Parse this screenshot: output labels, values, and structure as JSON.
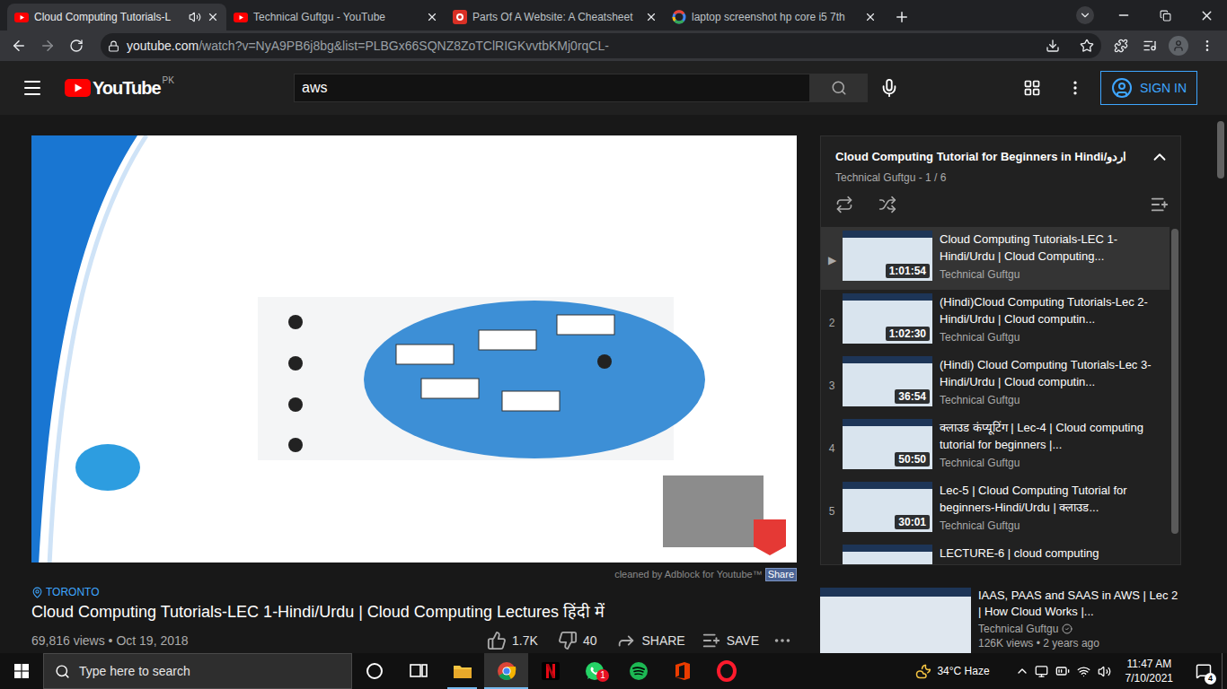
{
  "browser": {
    "tabs": [
      {
        "title": "Cloud Computing Tutorials-L",
        "selected": true,
        "audio": true,
        "kind": "youtube"
      },
      {
        "title": "Technical Guftgu - YouTube",
        "selected": false,
        "audio": false,
        "kind": "youtube"
      },
      {
        "title": "Parts Of A Website: A Cheatsheet",
        "selected": false,
        "audio": false,
        "kind": "cheatsheet"
      },
      {
        "title": "laptop screenshot hp core i5 7th",
        "selected": false,
        "audio": false,
        "kind": "google"
      }
    ],
    "url_host": "youtube.com",
    "url_path": "/watch?v=NyA9PB6j8bg&list=PLBGx66SQNZ8ZoTClRIGKvvtbKMj0rqCL-"
  },
  "youtube_header": {
    "logo": "YouTube",
    "region": "PK",
    "search_value": "aws",
    "sign_in": "SIGN IN"
  },
  "video": {
    "adblock_note": "cleaned by Adblock for Youtube™",
    "share_badge": "Share",
    "location": "TORONTO",
    "title": "Cloud Computing Tutorials-LEC 1-Hindi/Urdu | Cloud Computing Lectures हिंदी में",
    "meta": "69,816 views • Oct 19, 2018",
    "likes": "1.7K",
    "dislikes": "40",
    "share": "SHARE",
    "save": "SAVE"
  },
  "playlist": {
    "title": "Cloud Computing Tutorial for Beginners in Hindi/اردو",
    "subtitle": "Technical Guftgu - 1 / 6",
    "items": [
      {
        "index": "▶",
        "title": "Cloud Computing Tutorials-LEC 1-Hindi/Urdu | Cloud Computing...",
        "channel": "Technical Guftgu",
        "duration": "1:01:54",
        "selected": true
      },
      {
        "index": "2",
        "title": "(Hindi)Cloud Computing Tutorials-Lec 2-Hindi/Urdu | Cloud computin...",
        "channel": "Technical Guftgu",
        "duration": "1:02:30",
        "selected": false
      },
      {
        "index": "3",
        "title": "(Hindi) Cloud Computing Tutorials-Lec 3-Hindi/Urdu | Cloud computin...",
        "channel": "Technical Guftgu",
        "duration": "36:54",
        "selected": false
      },
      {
        "index": "4",
        "title": "क्लाउड कंप्यूटिंग | Lec-4 | Cloud computing tutorial for beginners |...",
        "channel": "Technical Guftgu",
        "duration": "50:50",
        "selected": false
      },
      {
        "index": "5",
        "title": "Lec-5 | Cloud Computing Tutorial for beginners-Hindi/Urdu | क्लाउड...",
        "channel": "Technical Guftgu",
        "duration": "30:01",
        "selected": false
      },
      {
        "title": "LECTURE-6 | cloud computing",
        "selected": false
      }
    ]
  },
  "recommended": [
    {
      "title": "IAAS, PAAS and SAAS in AWS | Lec 2 | How Cloud Works |...",
      "channel": "Technical Guftgu",
      "verified": true,
      "meta": "126K views • 2 years ago"
    }
  ],
  "taskbar": {
    "search_placeholder": "Type here to search",
    "apps": [
      {
        "kind": "cortana",
        "active": false,
        "running": false
      },
      {
        "kind": "task-view",
        "active": false,
        "running": false
      },
      {
        "kind": "file-explorer",
        "active": false,
        "running": true
      },
      {
        "kind": "chrome",
        "active": true,
        "running": true
      },
      {
        "kind": "netflix",
        "active": false,
        "running": false
      },
      {
        "kind": "whatsapp",
        "active": false,
        "running": false,
        "badge": "1"
      },
      {
        "kind": "spotify",
        "active": false,
        "running": false
      },
      {
        "kind": "office",
        "active": false,
        "running": false
      },
      {
        "kind": "opera",
        "active": false,
        "running": false
      }
    ],
    "weather": "34°C Haze",
    "time": "11:47 AM",
    "date": "7/10/2021",
    "notifications": "4"
  }
}
